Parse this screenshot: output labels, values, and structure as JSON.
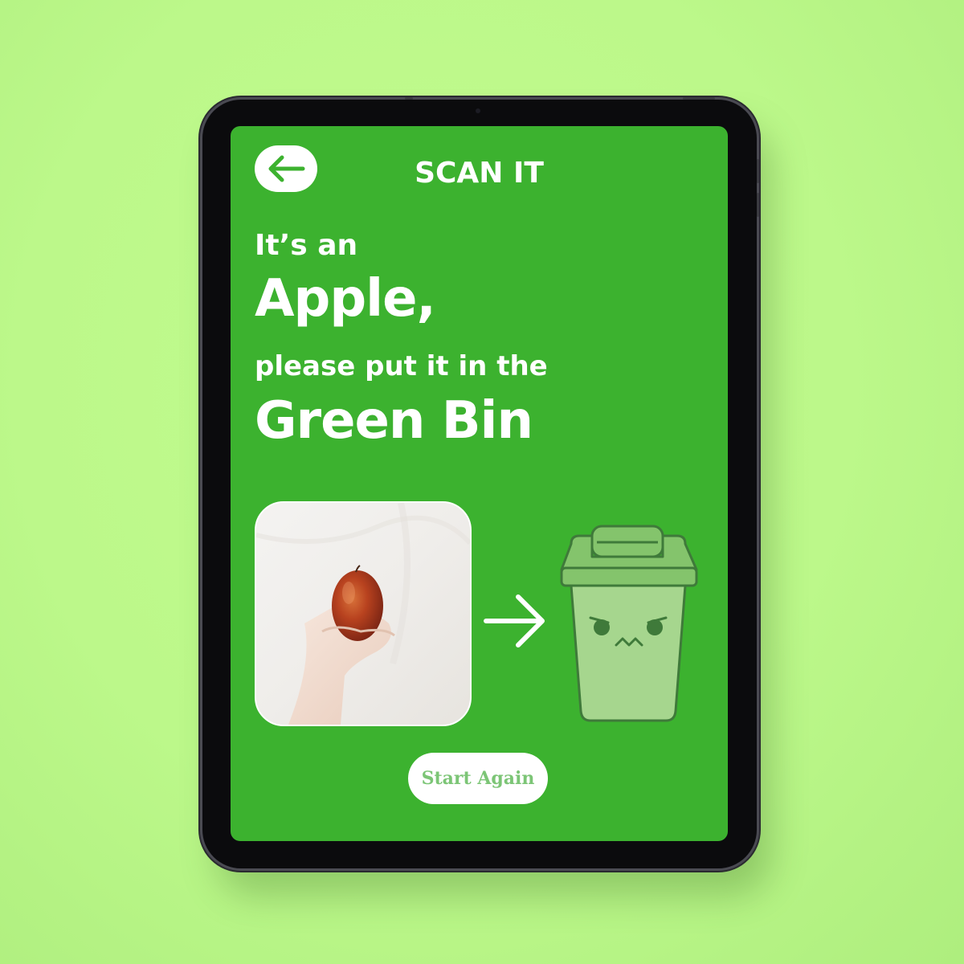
{
  "screen": {
    "title": "SCAN IT",
    "line_intro": "It’s an",
    "item_name": "Apple,",
    "line_instruction": "please put it in the",
    "bin_name": "Green Bin"
  },
  "buttons": {
    "start_again": "Start Again"
  },
  "icons": {
    "back": "back-arrow-icon",
    "direction": "right-arrow-icon",
    "bin": "green-bin-character-icon"
  },
  "colors": {
    "background": "#bdfa8c",
    "screen": "#3cb22f",
    "bin": "#a6d68e",
    "bin_outline": "#3f7a3a",
    "button_text": "#7cc576"
  }
}
